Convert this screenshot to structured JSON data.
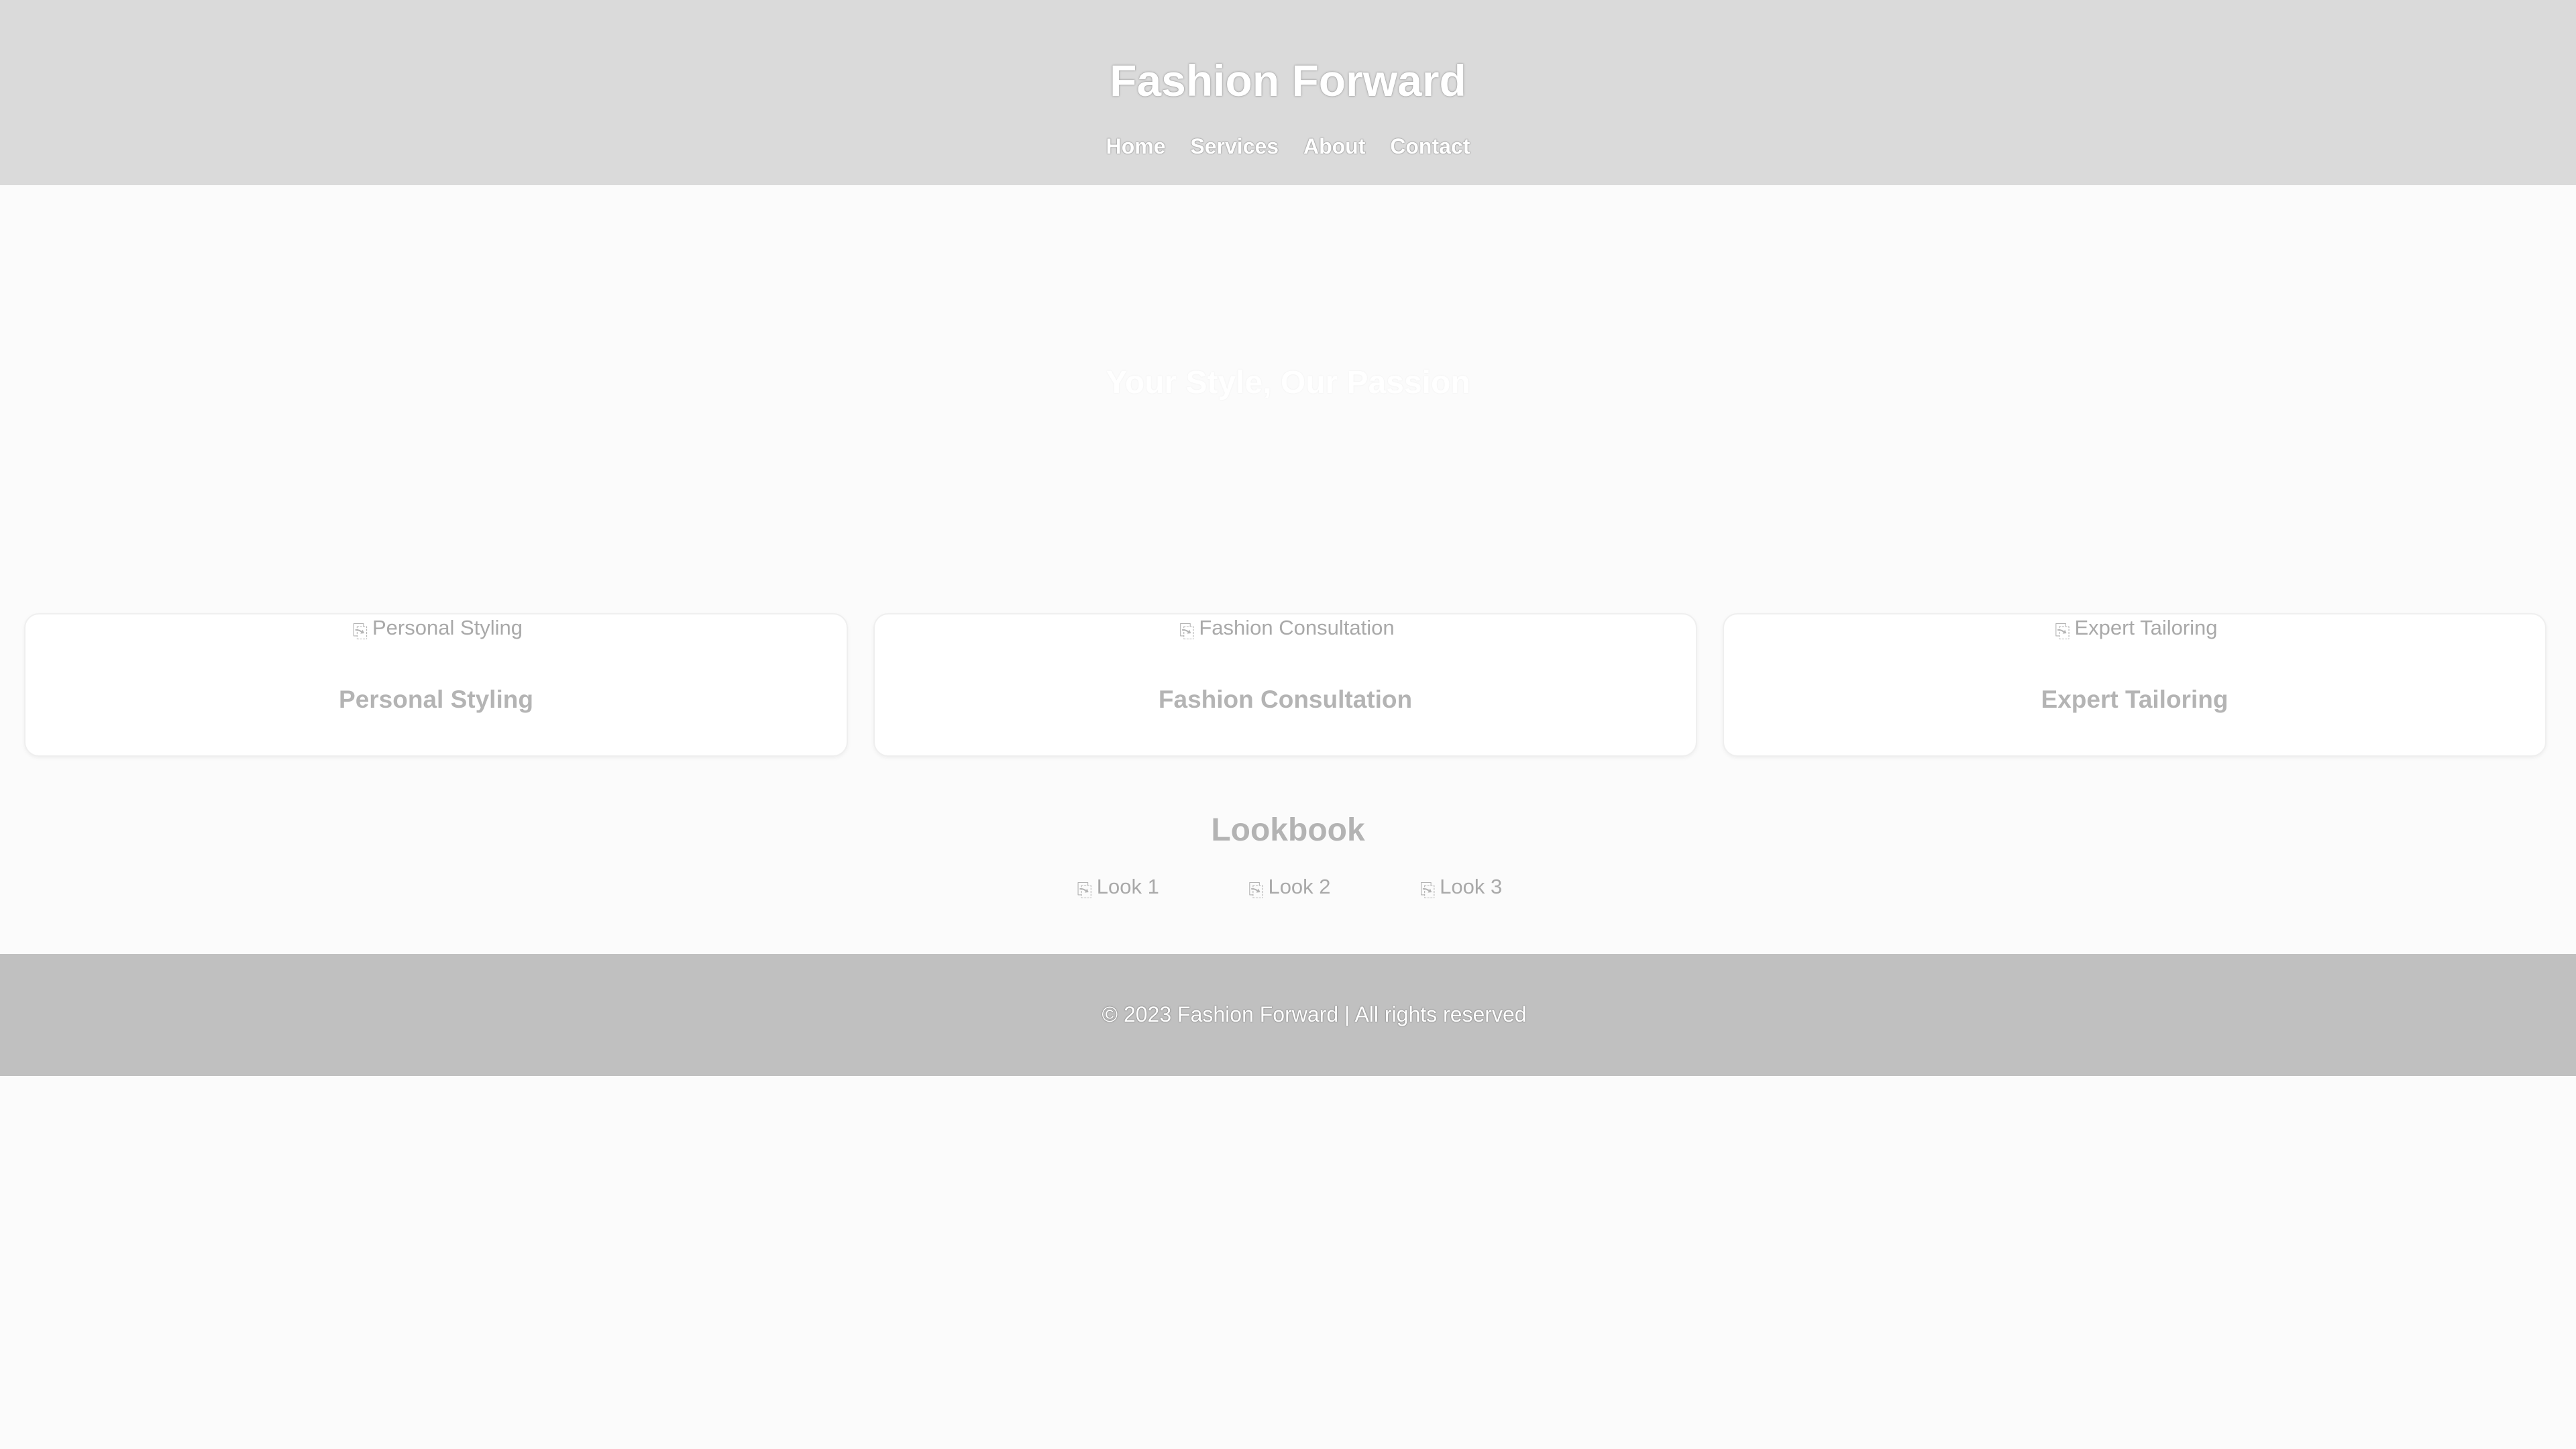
{
  "header": {
    "title": "Fashion Forward",
    "nav": [
      "Home",
      "Services",
      "About",
      "Contact"
    ]
  },
  "hero": {
    "title": "Your Style, Our Passion"
  },
  "services": [
    {
      "image_alt": "Personal Styling",
      "title": "Personal Styling"
    },
    {
      "image_alt": "Fashion Consultation",
      "title": "Fashion Consultation"
    },
    {
      "image_alt": "Expert Tailoring",
      "title": "Expert Tailoring"
    }
  ],
  "lookbook": {
    "heading": "Lookbook",
    "looks": [
      "Look 1",
      "Look 2",
      "Look 3"
    ]
  },
  "footer": {
    "text": "© 2023 Fashion Forward | All rights reserved"
  },
  "icons": {
    "broken_image": "broken-image-icon"
  }
}
